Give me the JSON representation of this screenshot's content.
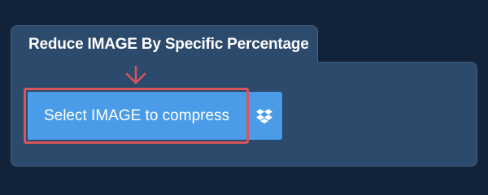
{
  "tab": {
    "title": "Reduce IMAGE By Specific Percentage"
  },
  "upload": {
    "select_label": "Select IMAGE to compress",
    "dropbox_icon": "dropbox-icon"
  },
  "annotation": {
    "arrow_icon": "arrow-down-icon",
    "highlight_color": "#d9555a"
  },
  "colors": {
    "background": "#13243a",
    "panel": "#2c4a6c",
    "button": "#4a9ce8"
  }
}
